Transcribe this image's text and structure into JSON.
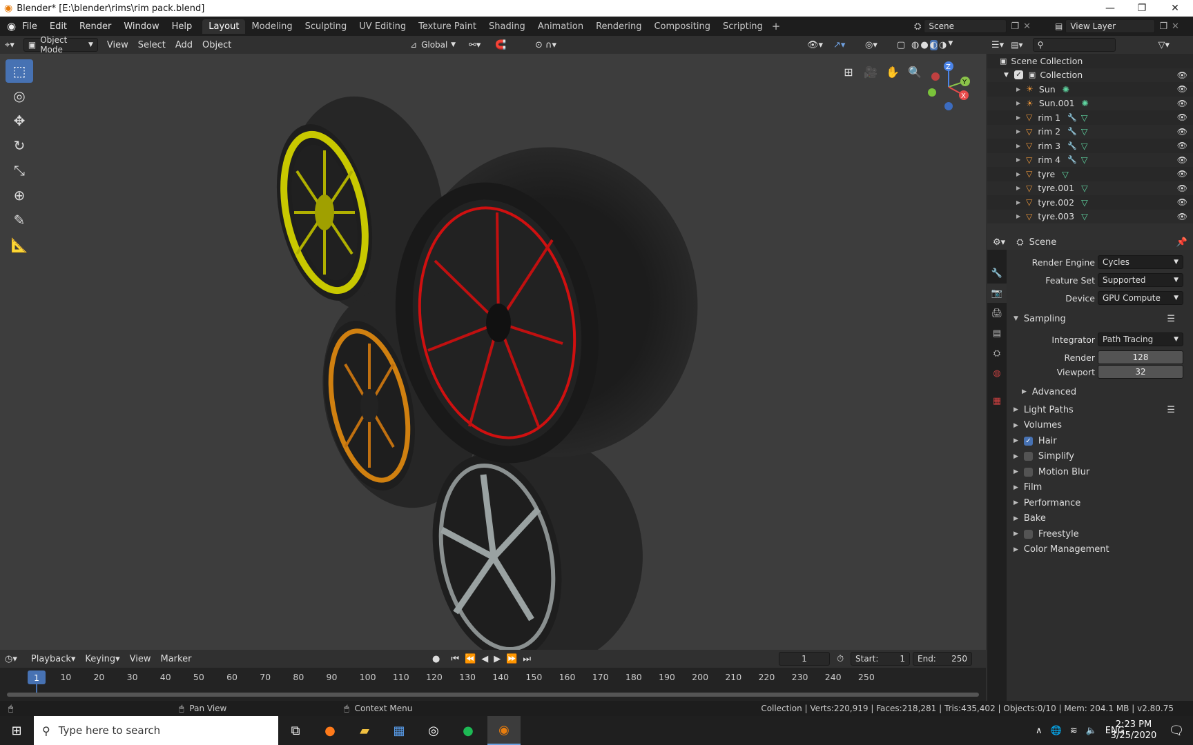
{
  "window": {
    "title": "Blender* [E:\\blender\\rims\\rim pack.blend]",
    "minimize": "—",
    "restore": "❐",
    "close": "✕"
  },
  "menu": [
    "File",
    "Edit",
    "Render",
    "Window",
    "Help"
  ],
  "workspaces": [
    "Layout",
    "Modeling",
    "Sculpting",
    "UV Editing",
    "Texture Paint",
    "Shading",
    "Animation",
    "Rendering",
    "Compositing",
    "Scripting"
  ],
  "scene_name": "Scene",
  "view_layer": "View Layer",
  "viewport_header": {
    "mode": "Object Mode",
    "menus": [
      "View",
      "Select",
      "Add",
      "Object"
    ],
    "transform": "Global"
  },
  "outliner": {
    "root": "Scene Collection",
    "collection": "Collection",
    "objects": [
      {
        "name": "Sun",
        "type": "light"
      },
      {
        "name": "Sun.001",
        "type": "light"
      },
      {
        "name": "rim 1",
        "type": "mesh",
        "modifier": true
      },
      {
        "name": "rim 2",
        "type": "mesh",
        "modifier": true
      },
      {
        "name": "rim 3",
        "type": "mesh",
        "modifier": true
      },
      {
        "name": "rim 4",
        "type": "mesh",
        "modifier": true
      },
      {
        "name": "tyre",
        "type": "mesh",
        "modifier": false
      },
      {
        "name": "tyre.001",
        "type": "mesh",
        "modifier": false
      },
      {
        "name": "tyre.002",
        "type": "mesh",
        "modifier": false
      },
      {
        "name": "tyre.003",
        "type": "mesh",
        "modifier": false
      }
    ]
  },
  "properties": {
    "context": "Scene",
    "render_engine_label": "Render Engine",
    "render_engine": "Cycles",
    "feature_set_label": "Feature Set",
    "feature_set": "Supported",
    "device_label": "Device",
    "device": "GPU Compute",
    "sampling": "Sampling",
    "integrator_label": "Integrator",
    "integrator": "Path Tracing",
    "render_label": "Render",
    "render_samples": "128",
    "viewport_label": "Viewport",
    "viewport_samples": "32",
    "advanced": "Advanced",
    "sections": [
      {
        "label": "Light Paths",
        "checkbox": null
      },
      {
        "label": "Volumes",
        "checkbox": null
      },
      {
        "label": "Hair",
        "checkbox": true
      },
      {
        "label": "Simplify",
        "checkbox": false
      },
      {
        "label": "Motion Blur",
        "checkbox": false
      },
      {
        "label": "Film",
        "checkbox": null
      },
      {
        "label": "Performance",
        "checkbox": null
      },
      {
        "label": "Bake",
        "checkbox": null
      },
      {
        "label": "Freestyle",
        "checkbox": false
      },
      {
        "label": "Color Management",
        "checkbox": null
      }
    ]
  },
  "timeline": {
    "menus": [
      "Playback",
      "Keying",
      "View",
      "Marker"
    ],
    "current_frame": "1",
    "start_label": "Start:",
    "start": "1",
    "end_label": "End:",
    "end": "250",
    "ticks": [
      "1",
      "10",
      "20",
      "30",
      "40",
      "50",
      "60",
      "70",
      "80",
      "90",
      "100",
      "110",
      "120",
      "130",
      "140",
      "150",
      "160",
      "170",
      "180",
      "190",
      "200",
      "210",
      "220",
      "230",
      "240",
      "250"
    ]
  },
  "status": {
    "pan": "Pan View",
    "context": "Context Menu",
    "stats": "Collection | Verts:220,919 | Faces:218,281 | Tris:435,402 | Objects:0/10 | Mem: 204.1 MB | v2.80.75"
  },
  "taskbar": {
    "search_placeholder": "Type here to search",
    "lang": "ENG",
    "time": "2:23 PM",
    "date": "3/25/2020"
  },
  "colors": {
    "accent": "#4772b3",
    "rim1": "#c8c800",
    "rim2": "#d01010",
    "rim3": "#d08010",
    "rim4": "#a0a8a8"
  }
}
